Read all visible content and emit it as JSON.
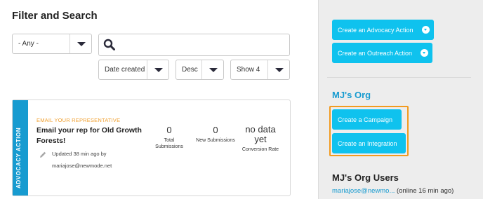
{
  "filter": {
    "title": "Filter and Search",
    "type_select": "- Any -",
    "sort_field": "Date created",
    "sort_order": "Desc",
    "page_size": "Show 4"
  },
  "card": {
    "category": "ADVOCACY ACTION",
    "type": "EMAIL YOUR REPRESENTATIVE",
    "name": "Email your rep for Old Growth Forests!",
    "updated": "Updated 38 min ago by",
    "updated_by": "mariajose@newmode.net",
    "stats": [
      {
        "value": "0",
        "label": "Total Submissions"
      },
      {
        "value": "0",
        "label": "New Submissions"
      },
      {
        "value": "no data yet",
        "label": "Conversion Rate"
      }
    ]
  },
  "sidebar": {
    "create_advocacy": "Create an Advocacy Action",
    "create_outreach": "Create an Outreach Action",
    "org_name": "MJ's Org",
    "create_campaign": "Create a Campaign",
    "create_integration": "Create an Integration",
    "users_title": "MJ's Org Users",
    "user_email": "mariajose@newmo...",
    "user_status": "(online 16 min ago)"
  },
  "colors": {
    "accent": "#0fc2ee",
    "brand_blue": "#179bd0",
    "highlight": "#f29b1f",
    "type_orange": "#f0a030"
  }
}
